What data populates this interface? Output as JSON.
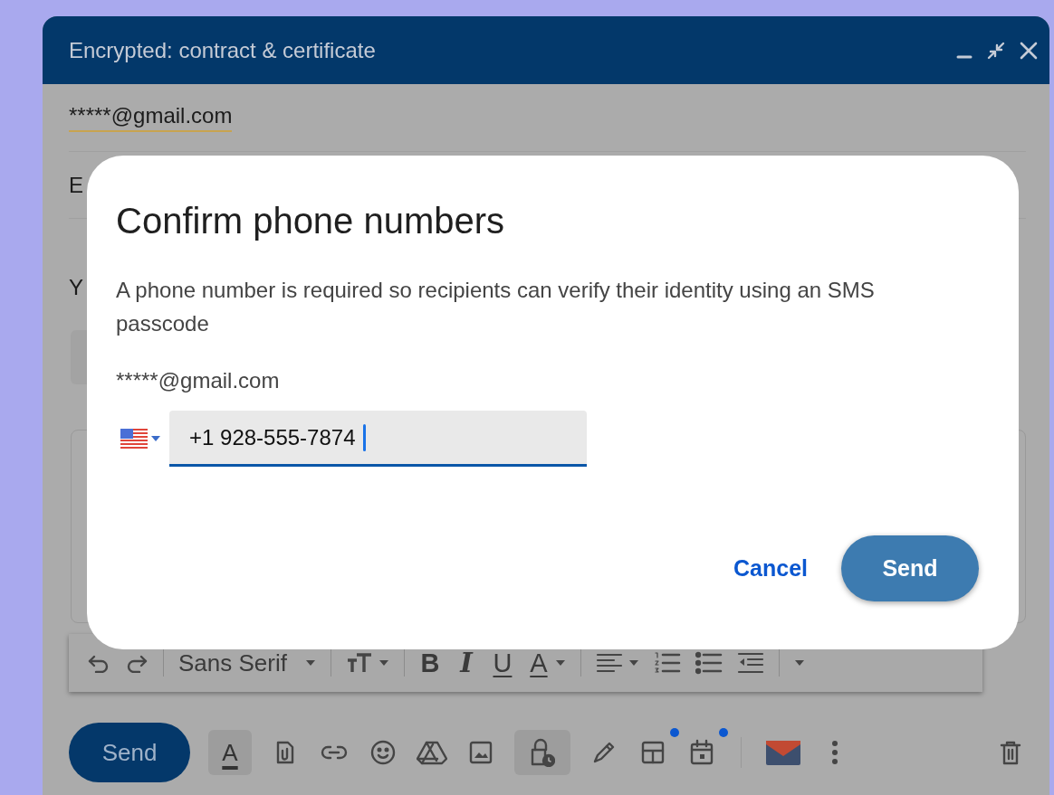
{
  "compose": {
    "title": "Encrypted: contract & certificate",
    "recipient": "*****@gmail.com",
    "row_2": "E",
    "row_3": "Y",
    "toolbar": [
      {
        "kind": "undo"
      },
      {
        "kind": "redo"
      },
      {
        "kind": "divider"
      },
      {
        "kind": "font",
        "label": "Sans Serif"
      },
      {
        "kind": "divider"
      },
      {
        "kind": "size"
      },
      {
        "kind": "divider"
      },
      {
        "kind": "bold",
        "label": "B"
      },
      {
        "kind": "italic",
        "label": "I"
      },
      {
        "kind": "underline",
        "label": "U"
      },
      {
        "kind": "color",
        "label": "A"
      },
      {
        "kind": "divider"
      },
      {
        "kind": "align"
      },
      {
        "kind": "numbered"
      },
      {
        "kind": "bulleted"
      },
      {
        "kind": "outdent"
      },
      {
        "kind": "divider"
      },
      {
        "kind": "more"
      }
    ],
    "send": "Send",
    "actions": [
      {
        "kind": "format",
        "label": "A",
        "selected": true,
        "dot": false
      },
      {
        "kind": "attach",
        "selected": false,
        "dot": false
      },
      {
        "kind": "link",
        "selected": false,
        "dot": false
      },
      {
        "kind": "emoji",
        "selected": false,
        "dot": false
      },
      {
        "kind": "drive",
        "selected": false,
        "dot": false
      },
      {
        "kind": "image",
        "selected": false,
        "dot": false
      },
      {
        "kind": "lock",
        "selected": true,
        "dot": false
      },
      {
        "kind": "pen",
        "selected": false,
        "dot": false
      },
      {
        "kind": "layout",
        "selected": false,
        "dot": true
      },
      {
        "kind": "calendar",
        "selected": false,
        "dot": true
      },
      {
        "kind": "divider"
      },
      {
        "kind": "envelope",
        "selected": false,
        "dot": false
      },
      {
        "kind": "more",
        "selected": false,
        "dot": false
      },
      {
        "kind": "spacer"
      },
      {
        "kind": "trash",
        "selected": false,
        "dot": false
      }
    ]
  },
  "dialog": {
    "title": "Confirm phone numbers",
    "message": "A phone number is required so recipients can verify their identity using an SMS passcode",
    "recipient": "*****@gmail.com",
    "phone": "+1 928-555-7874",
    "buttons": [
      {
        "kind": "text",
        "label": "Cancel"
      },
      {
        "kind": "filled",
        "label": "Send"
      }
    ]
  }
}
